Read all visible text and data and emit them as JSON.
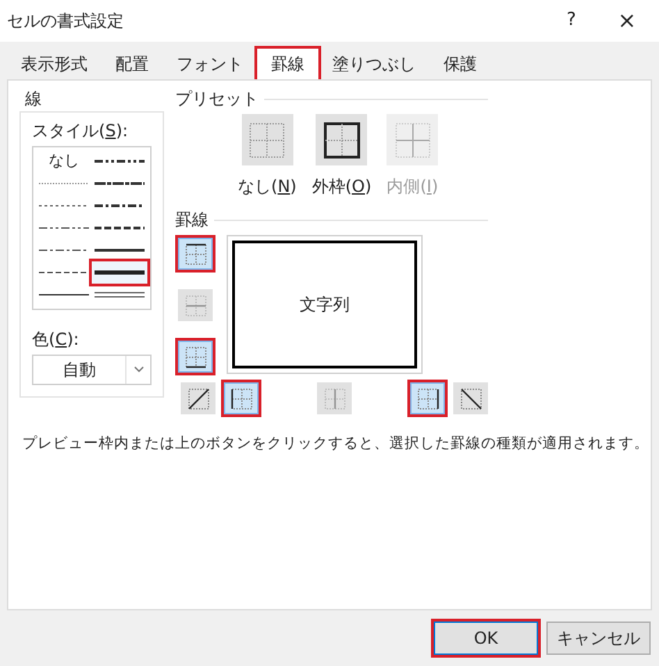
{
  "window": {
    "title": "セルの書式設定",
    "help": "?",
    "close": "×"
  },
  "tabs": [
    {
      "label": "表示形式",
      "selected": false,
      "highlighted": false
    },
    {
      "label": "配置",
      "selected": false,
      "highlighted": false
    },
    {
      "label": "フォント",
      "selected": false,
      "highlighted": false
    },
    {
      "label": "罫線",
      "selected": true,
      "highlighted": true
    },
    {
      "label": "塗りつぶし",
      "selected": false,
      "highlighted": false
    },
    {
      "label": "保護",
      "selected": false,
      "highlighted": false
    }
  ],
  "line": {
    "title": "線",
    "style_label": {
      "prefix": "スタイル(",
      "key": "S",
      "suffix": "):"
    },
    "styles": [
      [
        {
          "kind": "none",
          "text": "なし",
          "selected": false,
          "highlighted": false
        },
        {
          "kind": "hair",
          "selected": false,
          "highlighted": false
        },
        {
          "kind": "dotted",
          "selected": false,
          "highlighted": false
        },
        {
          "kind": "dash-dot-dot",
          "selected": false,
          "highlighted": false
        },
        {
          "kind": "dash-dot",
          "selected": false,
          "highlighted": false
        },
        {
          "kind": "dashed",
          "selected": false,
          "highlighted": false
        },
        {
          "kind": "thin",
          "selected": false,
          "highlighted": false
        }
      ],
      [
        {
          "kind": "medium-dash-dot-dot",
          "selected": false,
          "highlighted": false
        },
        {
          "kind": "slant-dash-dot",
          "selected": false,
          "highlighted": false
        },
        {
          "kind": "medium-dash-dot",
          "selected": false,
          "highlighted": false
        },
        {
          "kind": "medium-dashed",
          "selected": false,
          "highlighted": false
        },
        {
          "kind": "medium",
          "selected": false,
          "highlighted": false
        },
        {
          "kind": "thick",
          "selected": true,
          "highlighted": true
        },
        {
          "kind": "double",
          "selected": false,
          "highlighted": false
        }
      ]
    ],
    "color_label": {
      "prefix": "色(",
      "key": "C",
      "suffix": "):"
    },
    "color_value": "自動"
  },
  "presets": {
    "title": "プリセット",
    "items": [
      {
        "kind": "none",
        "label": {
          "prefix": "なし(",
          "key": "N",
          "suffix": ")"
        },
        "disabled": false
      },
      {
        "kind": "outline",
        "label": {
          "prefix": "外枠(",
          "key": "O",
          "suffix": ")"
        },
        "disabled": false
      },
      {
        "kind": "inside",
        "label": {
          "prefix": "内側(",
          "key": "I",
          "suffix": ")"
        },
        "disabled": true
      }
    ]
  },
  "borders": {
    "title": "罫線",
    "preview_text": "文字列",
    "vertical_buttons": [
      {
        "kind": "top",
        "on": true,
        "disabled": false,
        "highlighted": true
      },
      {
        "kind": "middle-horizontal",
        "on": false,
        "disabled": true,
        "highlighted": false
      },
      {
        "kind": "bottom",
        "on": true,
        "disabled": false,
        "highlighted": true
      }
    ],
    "horizontal_buttons": [
      {
        "kind": "diagonal-up",
        "on": false,
        "disabled": false,
        "highlighted": false
      },
      {
        "kind": "left",
        "on": true,
        "disabled": false,
        "highlighted": true
      },
      {
        "kind": "middle-vertical",
        "on": false,
        "disabled": true,
        "highlighted": false
      },
      {
        "kind": "right",
        "on": true,
        "disabled": false,
        "highlighted": true
      },
      {
        "kind": "diagonal-down",
        "on": false,
        "disabled": false,
        "highlighted": false
      }
    ]
  },
  "hint": "プレビュー枠内または上のボタンをクリックすると、選択した罫線の種類が適用されます。",
  "buttons": [
    {
      "label": "OK",
      "highlighted": true,
      "default": true
    },
    {
      "label": "キャンセル",
      "highlighted": false,
      "default": false
    }
  ]
}
